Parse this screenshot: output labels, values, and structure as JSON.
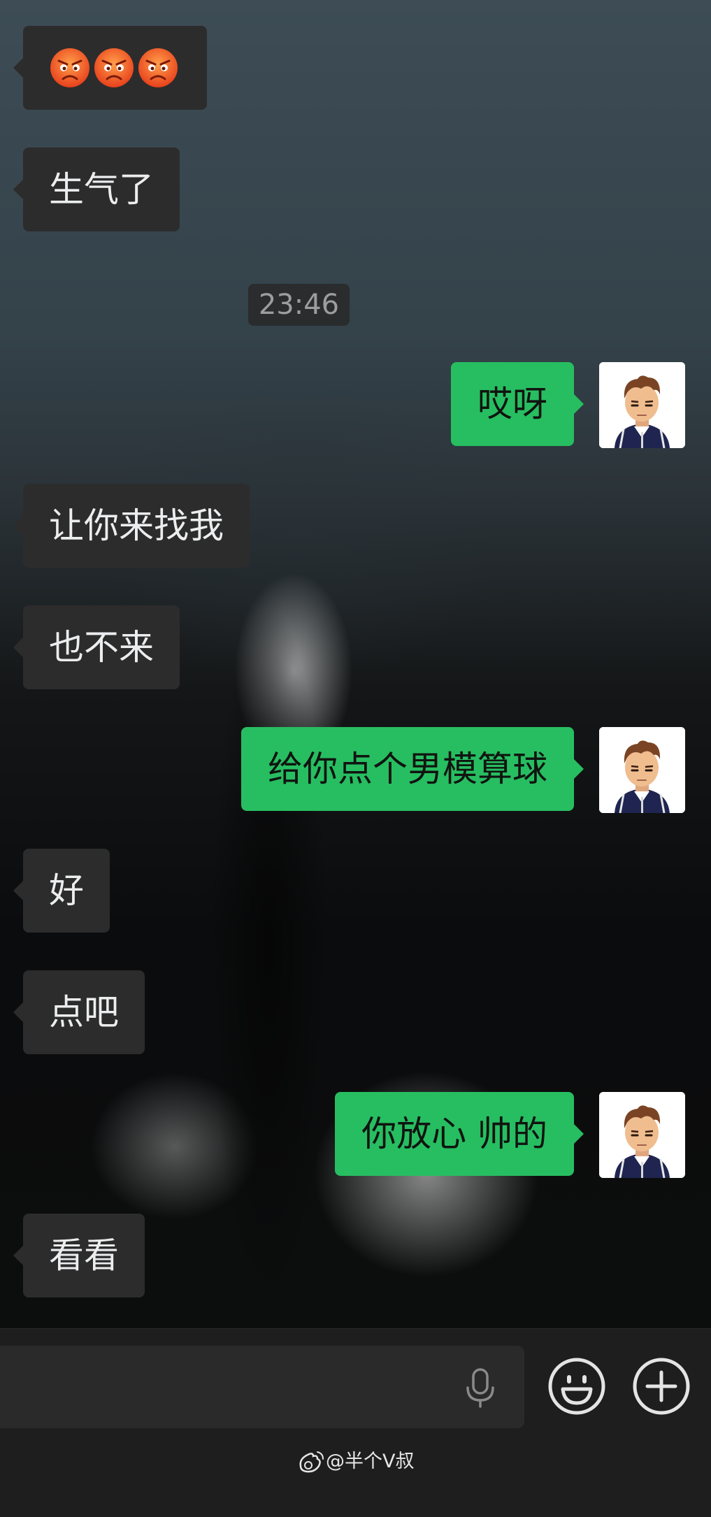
{
  "timestamp": "23:46",
  "messages": [
    {
      "side": "in",
      "text": "",
      "emoji": [
        "angry-emoji",
        "angry-emoji",
        "angry-emoji"
      ]
    },
    {
      "side": "in",
      "text": "生气了"
    },
    {
      "side": "out",
      "text": "哎呀"
    },
    {
      "side": "in",
      "text": "让你来找我"
    },
    {
      "side": "in",
      "text": "也不来"
    },
    {
      "side": "out",
      "text": "给你点个男模算球"
    },
    {
      "side": "in",
      "text": "好"
    },
    {
      "side": "in",
      "text": "点吧"
    },
    {
      "side": "out",
      "text": "你放心 帅的"
    },
    {
      "side": "in",
      "text": "看看"
    }
  ],
  "input_bar": {
    "icons": [
      "microphone-icon",
      "emoji-icon",
      "plus-icon"
    ]
  },
  "watermark": {
    "text": "@半个V叔",
    "icon": "weibo-icon"
  },
  "colors": {
    "incoming_bubble": "#2c2c2c",
    "outgoing_bubble": "#27be61",
    "input_bar": "#1e1e1e"
  }
}
